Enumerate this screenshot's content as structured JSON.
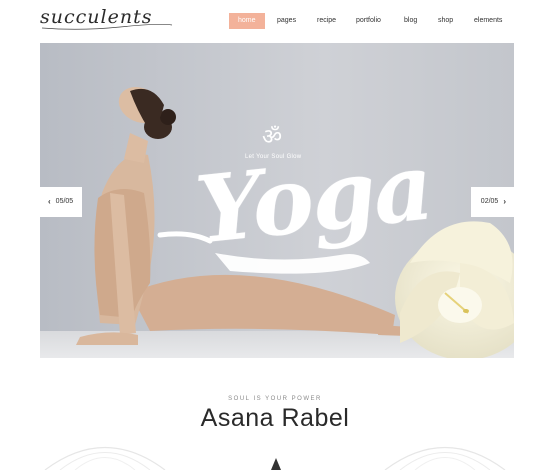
{
  "header": {
    "logo": "succulents",
    "nav": [
      {
        "label": "home",
        "active": true
      },
      {
        "label": "pages",
        "active": false
      },
      {
        "label": "recipe",
        "active": false
      },
      {
        "label": "portfolio",
        "active": false
      },
      {
        "label": "blog",
        "active": false
      },
      {
        "label": "shop",
        "active": false
      },
      {
        "label": "elements",
        "active": false
      }
    ]
  },
  "hero": {
    "om_symbol": "ॐ",
    "tagline": "Let Your Soul Glow",
    "script_word": "Yoga",
    "prev_label": "05/05",
    "next_label": "02/05"
  },
  "section": {
    "kicker": "SOUL IS YOUR POWER",
    "title": "Asana Rabel"
  },
  "colors": {
    "accent": "#f3b29a",
    "hero_bg": "#c9cbd0"
  },
  "icons": [
    "chevron-left-icon",
    "chevron-right-icon",
    "om-icon",
    "flower-image",
    "mandala-icon"
  ]
}
